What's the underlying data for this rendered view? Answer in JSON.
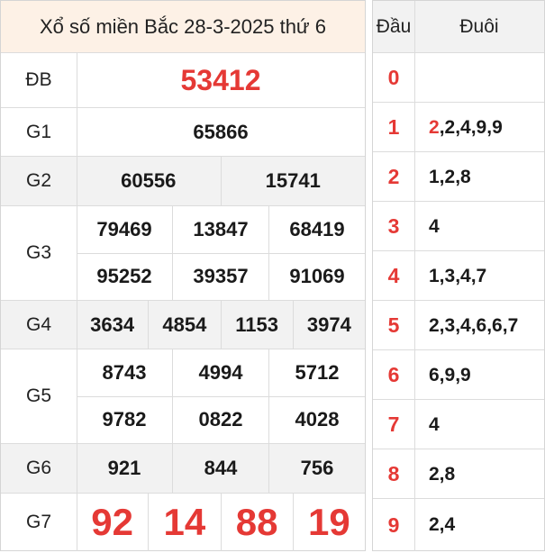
{
  "title": "Xổ số miền Bắc 28-3-2025 thứ 6",
  "prizes": [
    {
      "label": "ĐB",
      "lines": [
        [
          "53412"
        ]
      ]
    },
    {
      "label": "G1",
      "lines": [
        [
          "65866"
        ]
      ]
    },
    {
      "label": "G2",
      "lines": [
        [
          "60556",
          "15741"
        ]
      ]
    },
    {
      "label": "G3",
      "lines": [
        [
          "79469",
          "13847",
          "68419"
        ],
        [
          "95252",
          "39357",
          "91069"
        ]
      ]
    },
    {
      "label": "G4",
      "lines": [
        [
          "3634",
          "4854",
          "1153",
          "3974"
        ]
      ]
    },
    {
      "label": "G5",
      "lines": [
        [
          "8743",
          "4994",
          "5712"
        ],
        [
          "9782",
          "0822",
          "4028"
        ]
      ]
    },
    {
      "label": "G6",
      "lines": [
        [
          "921",
          "844",
          "756"
        ]
      ]
    },
    {
      "label": "G7",
      "lines": [
        [
          "92",
          "14",
          "88",
          "19"
        ]
      ]
    }
  ],
  "loto_table": {
    "header_dau": "Đầu",
    "header_duoi": "Đuôi",
    "rows": [
      {
        "dau": "0",
        "highlight": "",
        "rest": ""
      },
      {
        "dau": "1",
        "highlight": "2",
        "rest": ",2,4,9,9"
      },
      {
        "dau": "2",
        "highlight": "",
        "rest": "1,2,8"
      },
      {
        "dau": "3",
        "highlight": "",
        "rest": "4"
      },
      {
        "dau": "4",
        "highlight": "",
        "rest": "1,3,4,7"
      },
      {
        "dau": "5",
        "highlight": "",
        "rest": "2,3,4,6,6,7"
      },
      {
        "dau": "6",
        "highlight": "",
        "rest": "6,9,9"
      },
      {
        "dau": "7",
        "highlight": "",
        "rest": "4"
      },
      {
        "dau": "8",
        "highlight": "",
        "rest": "2,8"
      },
      {
        "dau": "9",
        "highlight": "",
        "rest": "2,4"
      }
    ]
  },
  "colors": {
    "accent_red": "#e53935",
    "title_bg": "#fdf1e6",
    "row_gray": "#f2f2f2"
  }
}
